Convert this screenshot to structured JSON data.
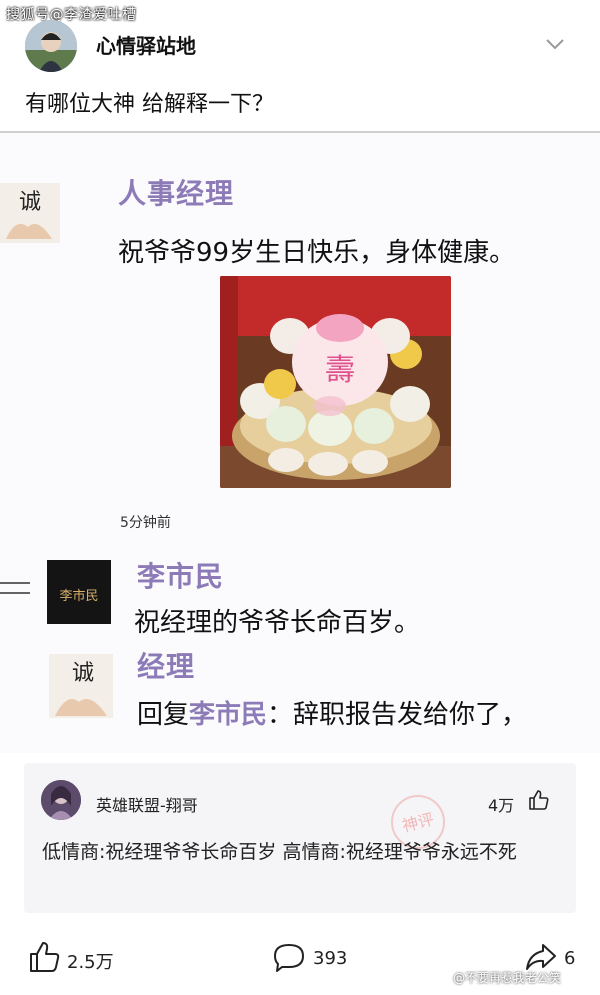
{
  "watermark_top": "搜狐号@李渣爱吐槽",
  "post": {
    "author": "心情驿站地",
    "text": "有哪位大神 给解释一下？"
  },
  "screenshot": {
    "first": {
      "name": "人事经理",
      "message": "祝爷爷99岁生日快乐，身体健康。",
      "avatar_glyph": "诚"
    },
    "time": "5分钟前",
    "second": {
      "name": "李市民",
      "message": "祝经理的爷爷长命百岁。",
      "avatar_text": "李市民"
    },
    "third": {
      "name": "经理",
      "reply_prefix": "回复",
      "reply_to": "李市民",
      "reply_text": "：辞职报告发给你了，",
      "avatar_glyph": "诚"
    }
  },
  "comment": {
    "author": "英雄联盟-翔哥",
    "likes": "4万",
    "text": "低情商:祝经理爷爷长命百岁  高情商:祝经理爷爷永远不死",
    "stamp": "神评"
  },
  "actions": {
    "likes": "2.5万",
    "comments": "393",
    "shares": "6"
  },
  "watermark_bottom": "@不要再惹我老公笑"
}
